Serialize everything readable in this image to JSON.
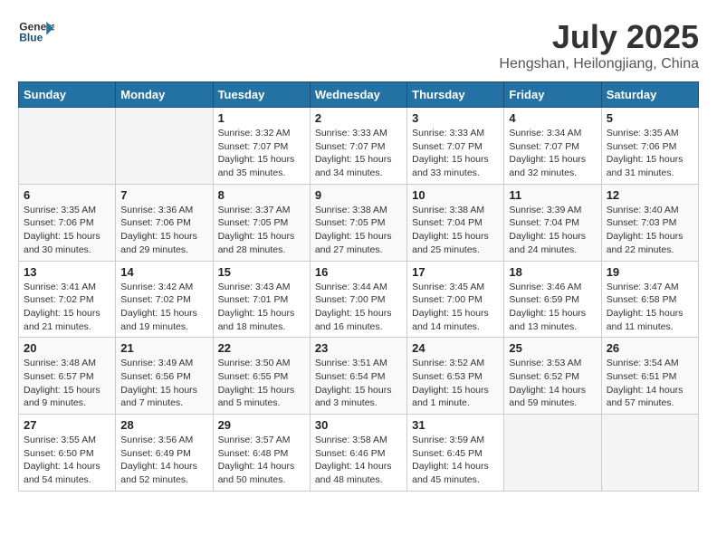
{
  "header": {
    "logo_general": "General",
    "logo_blue": "Blue",
    "month_year": "July 2025",
    "location": "Hengshan, Heilongjiang, China"
  },
  "weekdays": [
    "Sunday",
    "Monday",
    "Tuesday",
    "Wednesday",
    "Thursday",
    "Friday",
    "Saturday"
  ],
  "weeks": [
    [
      {
        "day": "",
        "sunrise": "",
        "sunset": "",
        "daylight": ""
      },
      {
        "day": "",
        "sunrise": "",
        "sunset": "",
        "daylight": ""
      },
      {
        "day": "1",
        "sunrise": "Sunrise: 3:32 AM",
        "sunset": "Sunset: 7:07 PM",
        "daylight": "Daylight: 15 hours and 35 minutes."
      },
      {
        "day": "2",
        "sunrise": "Sunrise: 3:33 AM",
        "sunset": "Sunset: 7:07 PM",
        "daylight": "Daylight: 15 hours and 34 minutes."
      },
      {
        "day": "3",
        "sunrise": "Sunrise: 3:33 AM",
        "sunset": "Sunset: 7:07 PM",
        "daylight": "Daylight: 15 hours and 33 minutes."
      },
      {
        "day": "4",
        "sunrise": "Sunrise: 3:34 AM",
        "sunset": "Sunset: 7:07 PM",
        "daylight": "Daylight: 15 hours and 32 minutes."
      },
      {
        "day": "5",
        "sunrise": "Sunrise: 3:35 AM",
        "sunset": "Sunset: 7:06 PM",
        "daylight": "Daylight: 15 hours and 31 minutes."
      }
    ],
    [
      {
        "day": "6",
        "sunrise": "Sunrise: 3:35 AM",
        "sunset": "Sunset: 7:06 PM",
        "daylight": "Daylight: 15 hours and 30 minutes."
      },
      {
        "day": "7",
        "sunrise": "Sunrise: 3:36 AM",
        "sunset": "Sunset: 7:06 PM",
        "daylight": "Daylight: 15 hours and 29 minutes."
      },
      {
        "day": "8",
        "sunrise": "Sunrise: 3:37 AM",
        "sunset": "Sunset: 7:05 PM",
        "daylight": "Daylight: 15 hours and 28 minutes."
      },
      {
        "day": "9",
        "sunrise": "Sunrise: 3:38 AM",
        "sunset": "Sunset: 7:05 PM",
        "daylight": "Daylight: 15 hours and 27 minutes."
      },
      {
        "day": "10",
        "sunrise": "Sunrise: 3:38 AM",
        "sunset": "Sunset: 7:04 PM",
        "daylight": "Daylight: 15 hours and 25 minutes."
      },
      {
        "day": "11",
        "sunrise": "Sunrise: 3:39 AM",
        "sunset": "Sunset: 7:04 PM",
        "daylight": "Daylight: 15 hours and 24 minutes."
      },
      {
        "day": "12",
        "sunrise": "Sunrise: 3:40 AM",
        "sunset": "Sunset: 7:03 PM",
        "daylight": "Daylight: 15 hours and 22 minutes."
      }
    ],
    [
      {
        "day": "13",
        "sunrise": "Sunrise: 3:41 AM",
        "sunset": "Sunset: 7:02 PM",
        "daylight": "Daylight: 15 hours and 21 minutes."
      },
      {
        "day": "14",
        "sunrise": "Sunrise: 3:42 AM",
        "sunset": "Sunset: 7:02 PM",
        "daylight": "Daylight: 15 hours and 19 minutes."
      },
      {
        "day": "15",
        "sunrise": "Sunrise: 3:43 AM",
        "sunset": "Sunset: 7:01 PM",
        "daylight": "Daylight: 15 hours and 18 minutes."
      },
      {
        "day": "16",
        "sunrise": "Sunrise: 3:44 AM",
        "sunset": "Sunset: 7:00 PM",
        "daylight": "Daylight: 15 hours and 16 minutes."
      },
      {
        "day": "17",
        "sunrise": "Sunrise: 3:45 AM",
        "sunset": "Sunset: 7:00 PM",
        "daylight": "Daylight: 15 hours and 14 minutes."
      },
      {
        "day": "18",
        "sunrise": "Sunrise: 3:46 AM",
        "sunset": "Sunset: 6:59 PM",
        "daylight": "Daylight: 15 hours and 13 minutes."
      },
      {
        "day": "19",
        "sunrise": "Sunrise: 3:47 AM",
        "sunset": "Sunset: 6:58 PM",
        "daylight": "Daylight: 15 hours and 11 minutes."
      }
    ],
    [
      {
        "day": "20",
        "sunrise": "Sunrise: 3:48 AM",
        "sunset": "Sunset: 6:57 PM",
        "daylight": "Daylight: 15 hours and 9 minutes."
      },
      {
        "day": "21",
        "sunrise": "Sunrise: 3:49 AM",
        "sunset": "Sunset: 6:56 PM",
        "daylight": "Daylight: 15 hours and 7 minutes."
      },
      {
        "day": "22",
        "sunrise": "Sunrise: 3:50 AM",
        "sunset": "Sunset: 6:55 PM",
        "daylight": "Daylight: 15 hours and 5 minutes."
      },
      {
        "day": "23",
        "sunrise": "Sunrise: 3:51 AM",
        "sunset": "Sunset: 6:54 PM",
        "daylight": "Daylight: 15 hours and 3 minutes."
      },
      {
        "day": "24",
        "sunrise": "Sunrise: 3:52 AM",
        "sunset": "Sunset: 6:53 PM",
        "daylight": "Daylight: 15 hours and 1 minute."
      },
      {
        "day": "25",
        "sunrise": "Sunrise: 3:53 AM",
        "sunset": "Sunset: 6:52 PM",
        "daylight": "Daylight: 14 hours and 59 minutes."
      },
      {
        "day": "26",
        "sunrise": "Sunrise: 3:54 AM",
        "sunset": "Sunset: 6:51 PM",
        "daylight": "Daylight: 14 hours and 57 minutes."
      }
    ],
    [
      {
        "day": "27",
        "sunrise": "Sunrise: 3:55 AM",
        "sunset": "Sunset: 6:50 PM",
        "daylight": "Daylight: 14 hours and 54 minutes."
      },
      {
        "day": "28",
        "sunrise": "Sunrise: 3:56 AM",
        "sunset": "Sunset: 6:49 PM",
        "daylight": "Daylight: 14 hours and 52 minutes."
      },
      {
        "day": "29",
        "sunrise": "Sunrise: 3:57 AM",
        "sunset": "Sunset: 6:48 PM",
        "daylight": "Daylight: 14 hours and 50 minutes."
      },
      {
        "day": "30",
        "sunrise": "Sunrise: 3:58 AM",
        "sunset": "Sunset: 6:46 PM",
        "daylight": "Daylight: 14 hours and 48 minutes."
      },
      {
        "day": "31",
        "sunrise": "Sunrise: 3:59 AM",
        "sunset": "Sunset: 6:45 PM",
        "daylight": "Daylight: 14 hours and 45 minutes."
      },
      {
        "day": "",
        "sunrise": "",
        "sunset": "",
        "daylight": ""
      },
      {
        "day": "",
        "sunrise": "",
        "sunset": "",
        "daylight": ""
      }
    ]
  ]
}
